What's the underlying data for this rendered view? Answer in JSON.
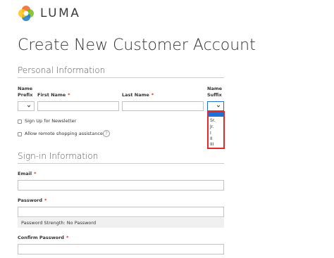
{
  "brand": {
    "name": "LUMA"
  },
  "page": {
    "title": "Create New Customer Account"
  },
  "personal": {
    "section_title": "Personal Information",
    "prefix_label_line1": "Name",
    "prefix_label_line2": "Prefix",
    "first_name_label": "First Name",
    "last_name_label": "Last Name",
    "suffix_label_line1": "Name",
    "suffix_label_line2": "Suffix",
    "required_mark": "*",
    "newsletter_label": "Sign Up for Newsletter",
    "assistance_label": "Allow remote shopping assistance",
    "help_glyph": "?"
  },
  "suffix_options": [
    "",
    "Sr.",
    "Jr.",
    "I",
    "II",
    "III"
  ],
  "signin": {
    "section_title": "Sign-in Information",
    "email_label": "Email",
    "password_label": "Password",
    "strength_text": "Password Strength: No Password",
    "confirm_label": "Confirm Password",
    "required_mark": "*"
  },
  "colors": {
    "required": "#e02b27",
    "selected_option": "#1e6fd9",
    "dropdown_border": "#e02b27",
    "logo": [
      "#f26322",
      "#76bc21",
      "#1979c3",
      "#ffc20e"
    ]
  },
  "icons": {
    "select_arrow": "chevron-down-icon",
    "help": "question-circle-icon",
    "logo": "luma-logo-icon"
  }
}
